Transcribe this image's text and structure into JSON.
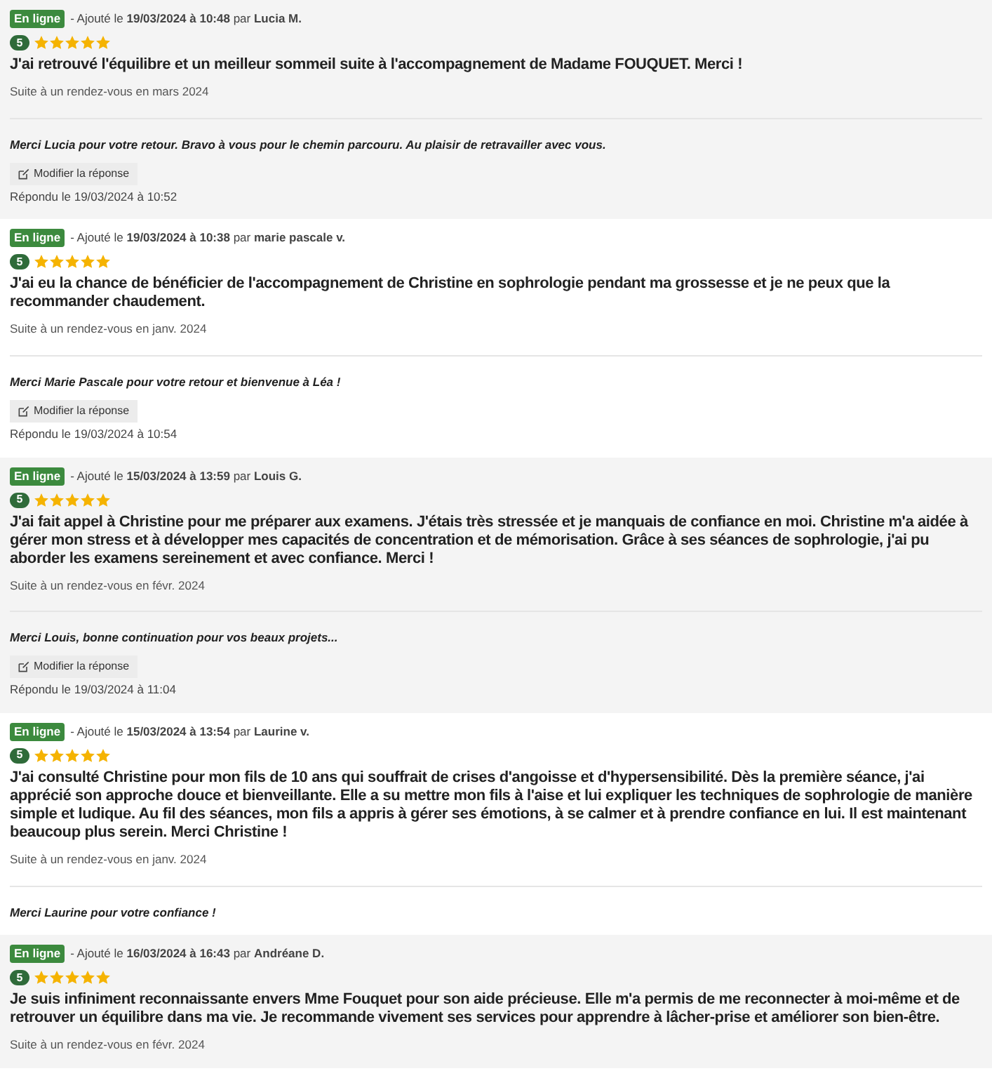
{
  "reviews": [
    {
      "status": "En ligne",
      "meta": "- Ajouté le **19/03/2024 à 10:48** par **Lucia M.**",
      "rating": "5",
      "stars": 5,
      "text": "J'ai retrouvé l'équilibre et un meilleur sommeil suite à l'accompagnement de Madame FOUQUET. Merci !",
      "visit": "Suite à un rendez-vous en mars 2024",
      "reply": "Merci Lucia pour votre retour. Bravo à vous pour le chemin parcouru. Au plaisir de retravailler avec vous.",
      "edit_button": "Modifier la réponse",
      "replied": "Répondu le 19/03/2024 à 10:52"
    },
    {
      "status": "En ligne",
      "meta": "- Ajouté le **19/03/2024 à 10:38** par **marie pascale v.**",
      "rating": "5",
      "stars": 5,
      "text": "J'ai eu la chance de bénéficier de l'accompagnement de Christine en sophrologie pendant ma grossesse et je ne peux que la recommander chaudement.",
      "visit": "Suite à un rendez-vous en janv. 2024",
      "reply": "Merci Marie Pascale pour votre retour et bienvenue à Léa !",
      "edit_button": "Modifier la réponse",
      "replied": "Répondu le 19/03/2024 à 10:54"
    },
    {
      "status": "En ligne",
      "meta": "- Ajouté le **15/03/2024 à 13:59** par **Louis G.**",
      "rating": "5",
      "stars": 5,
      "text": "J'ai fait appel à Christine pour me préparer aux examens. J'étais très stressée et je manquais de confiance en moi. Christine m'a aidée à gérer mon stress et à développer mes capacités de concentration et de mémorisation. Grâce à ses séances de sophrologie, j'ai pu aborder les examens sereinement et avec confiance. Merci !",
      "visit": "Suite à un rendez-vous en févr. 2024",
      "reply": "Merci Louis, bonne continuation pour vos beaux projets...",
      "edit_button": "Modifier la réponse",
      "replied": "Répondu le 19/03/2024 à 11:04"
    },
    {
      "status": "En ligne",
      "meta": "- Ajouté le **15/03/2024 à 13:54** par **Laurine v.**",
      "rating": "5",
      "stars": 5,
      "text": "J'ai consulté Christine pour mon fils de 10 ans qui souffrait de crises d'angoisse et d'hypersensibilité. Dès la première séance, j'ai apprécié son approche douce et bienveillante. Elle a su mettre mon fils à l'aise et lui expliquer les techniques de sophrologie de manière simple et ludique. Au fil des séances, mon fils a appris à gérer ses émotions, à se calmer et à prendre confiance en lui. Il est maintenant beaucoup plus serein. Merci Christine !",
      "visit": "Suite à un rendez-vous en janv. 2024",
      "reply": "Merci Laurine pour votre confiance !"
    },
    {
      "status": "En ligne",
      "meta": "- Ajouté le **16/03/2024 à 16:43** par **Andréane D.**",
      "rating": "5",
      "stars": 5,
      "text": "Je suis infiniment reconnaissante envers Mme Fouquet pour son aide précieuse. Elle m'a permis de me reconnecter à moi-même et de retrouver un équilibre dans ma vie. Je recommande vivement ses services pour apprendre à lâcher-prise et améliorer son bien-être.",
      "visit": "Suite à un rendez-vous en févr. 2024"
    }
  ]
}
